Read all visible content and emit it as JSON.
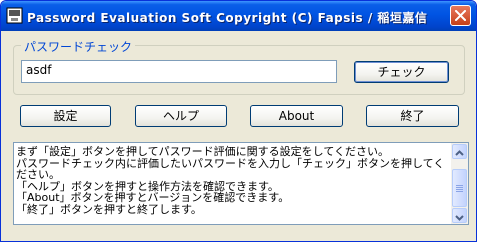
{
  "window": {
    "title": "Password Evaluation Soft Copyright (C) Fapsis / 稲垣嘉信"
  },
  "password_group": {
    "label": "パスワードチェック",
    "input_value": "asdf",
    "check_label": "チェック"
  },
  "buttons": {
    "settings": "設定",
    "help": "ヘルプ",
    "about": "About",
    "exit": "終了"
  },
  "memo": {
    "text": "まず「設定」ボタンを押してパスワード評価に関する設定をしてください。\nパスワードチェック内に評価したいパスワードを入力し「チェック」ボタンを押してください。\n「ヘルプ」ボタンを押すと操作方法を確認できます。\n「About」ボタンを押すとバージョンを確認できます。\n「終了」ボタンを押すと終了します。"
  },
  "colors": {
    "titlebar": "#0054e3",
    "close_button": "#c63f18",
    "window_face": "#ece9d8",
    "group_label": "#0046d5"
  },
  "icons": {
    "app": "app-icon",
    "close": "close-icon",
    "scroll_up": "chevron-up-icon",
    "scroll_down": "chevron-down-icon"
  }
}
